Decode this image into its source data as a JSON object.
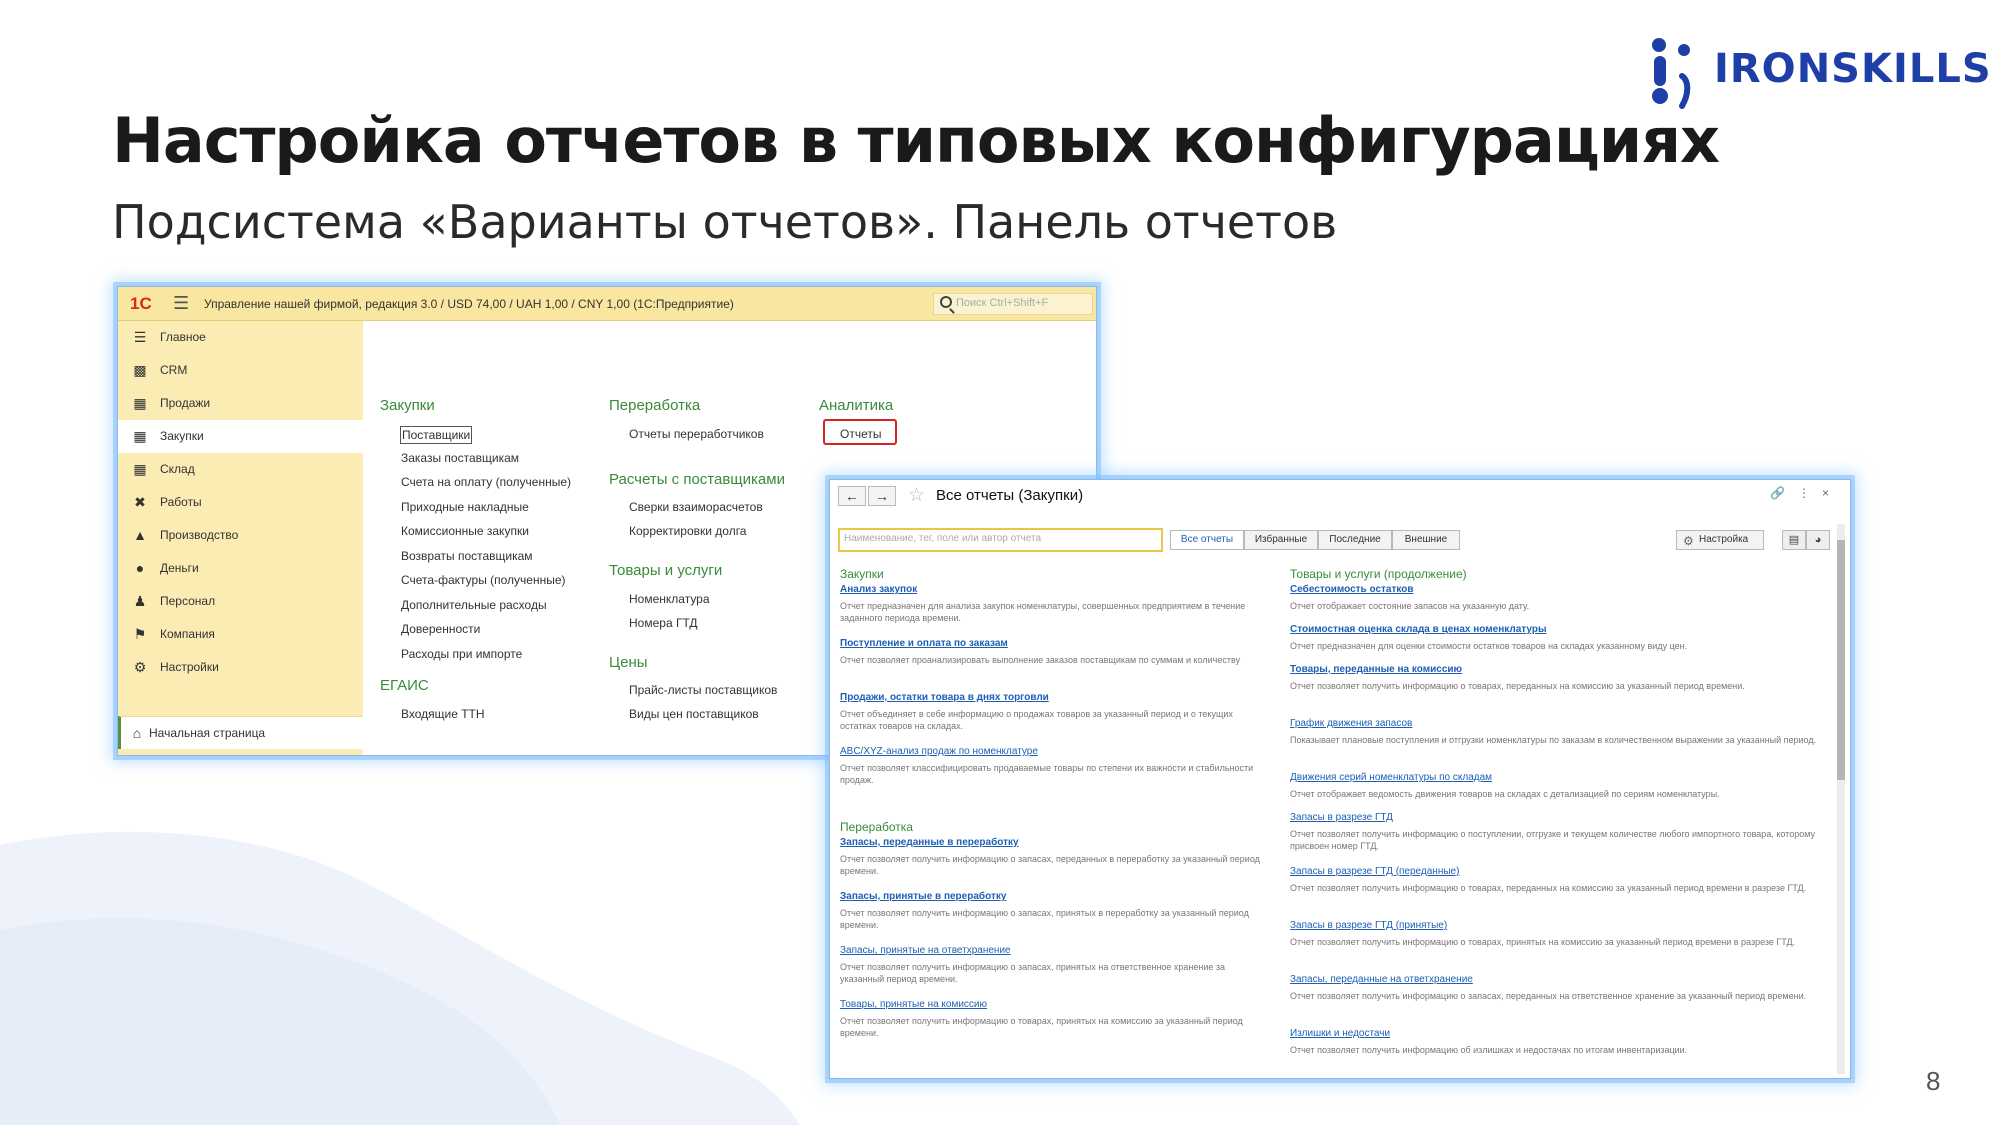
{
  "slide": {
    "brand": "IRONSKILLS",
    "title": "Настройка отчетов в типовых конфигурациях",
    "subtitle": "Подсистема «Варианты отчетов». Панель отчетов",
    "page_number": "8"
  },
  "colors": {
    "brand_blue": "#1f3fa8",
    "onec_yellow": "#f9e6a0",
    "section_green": "#3a8b3a",
    "link_blue": "#1e5fb4",
    "highlight_red": "#d32424"
  },
  "window1": {
    "logo": "1С",
    "app_title": "Управление нашей фирмой, редакция 3.0 / USD 74,00 / UAH 1,00 / CNY 1,00  (1С:Предприятие)",
    "search_placeholder": "Поиск Ctrl+Shift+F",
    "sidebar": [
      {
        "label": "Главное",
        "icon": "menu-icon"
      },
      {
        "label": "CRM",
        "icon": "crm-icon"
      },
      {
        "label": "Продажи",
        "icon": "cart-icon"
      },
      {
        "label": "Закупки",
        "icon": "grid-icon"
      },
      {
        "label": "Склад",
        "icon": "warehouse-icon"
      },
      {
        "label": "Работы",
        "icon": "tools-icon"
      },
      {
        "label": "Производство",
        "icon": "factory-icon"
      },
      {
        "label": "Деньги",
        "icon": "money-icon"
      },
      {
        "label": "Персонал",
        "icon": "people-icon"
      },
      {
        "label": "Компания",
        "icon": "flag-icon"
      },
      {
        "label": "Настройки",
        "icon": "gear-icon"
      }
    ],
    "home": "Начальная страница",
    "sections": {
      "zakupki": {
        "title": "Закупки",
        "items": [
          "Поставщики",
          "Заказы поставщикам",
          "Счета на оплату (полученные)",
          "Приходные накладные",
          "Комиссионные закупки",
          "Возвраты поставщикам",
          "Счета-фактуры (полученные)",
          "Дополнительные расходы",
          "Доверенности",
          "Расходы при импорте"
        ]
      },
      "egais": {
        "title": "ЕГАИС",
        "items": [
          "Входящие ТТН"
        ]
      },
      "pererabotka": {
        "title": "Переработка",
        "items": [
          "Отчеты переработчиков"
        ]
      },
      "raschety": {
        "title": "Расчеты с поставщиками",
        "items": [
          "Сверки взаиморасчетов",
          "Корректировки долга"
        ]
      },
      "tovary": {
        "title": "Товары и услуги",
        "items": [
          "Номенклатура",
          "Номера ГТД"
        ]
      },
      "ceny": {
        "title": "Цены",
        "items": [
          "Прайс-листы поставщиков",
          "Виды цен поставщиков"
        ]
      },
      "analitika": {
        "title": "Аналитика",
        "items": [
          "Отчеты"
        ]
      }
    }
  },
  "window2": {
    "title": "Все отчеты (Закупки)",
    "search_placeholder": "Наименование, тег, поле или автор отчета",
    "tabs": [
      "Все отчеты",
      "Избранные",
      "Последние",
      "Внешние"
    ],
    "settings_label": "Настройка",
    "left_column": [
      {
        "group": "Закупки",
        "reports": [
          {
            "name": "Анализ закупок",
            "desc": "Отчет предназначен для анализа закупок номенклатуры, совершенных предприятием в течение заданного периода времени."
          },
          {
            "name": "Поступление и оплата по заказам",
            "desc": "Отчет позволяет проанализировать выполнение заказов поставщикам по суммам и количеству"
          },
          {
            "name": "Продажи, остатки товара в днях торговли",
            "desc": "Отчет объединяет в себе информацию о продажах товаров за указанный период и о текущих остатках товаров на складах."
          },
          {
            "name": "ABC/XYZ-анализ продаж по номенклатуре",
            "desc": "Отчет позволяет классифицировать продаваемые товары по степени их важности и стабильности продаж."
          }
        ]
      },
      {
        "group": "Переработка",
        "reports": [
          {
            "name": "Запасы, переданные в переработку",
            "desc": "Отчет позволяет получить информацию о запасах, переданных в переработку за указанный период времени."
          },
          {
            "name": "Запасы, принятые в переработку",
            "desc": "Отчет позволяет получить информацию о запасах, принятых в переработку за указанный период времени."
          },
          {
            "name": "Запасы, принятые на ответхранение",
            "desc": "Отчет позволяет получить информацию о запасах, принятых на ответственное хранение за указанный период времени."
          },
          {
            "name": "Товары, принятые на комиссию",
            "desc": "Отчет позволяет получить информацию о товарах, принятых на комиссию за указанный период времени."
          }
        ]
      }
    ],
    "right_column": {
      "group": "Товары и услуги (продолжение)",
      "reports": [
        {
          "name": "Себестоимость остатков",
          "desc": "Отчет отображает состояние запасов на указанную дату."
        },
        {
          "name": "Стоимостная оценка склада в ценах номенклатуры",
          "desc": "Отчет предназначен для оценки стоимости остатков товаров на складах указанному виду цен."
        },
        {
          "name": "Товары, переданные на комиссию",
          "desc": "Отчет позволяет получить информацию о товарах, переданных на комиссию за указанный период времени."
        },
        {
          "name": "График движения запасов",
          "desc": "Показывает плановые поступления и отгрузки номенклатуры по заказам в количественном выражении за указанный период."
        },
        {
          "name": "Движения серий номенклатуры по складам",
          "desc": "Отчет отображает ведомость движения товаров на складах с детализацией по сериям номенклатуры."
        },
        {
          "name": "Запасы в разрезе ГТД",
          "desc": "Отчет позволяет получить информацию о поступлении, отгрузке и текущем количестве любого импортного товара, которому присвоен номер ГТД."
        },
        {
          "name": "Запасы в разрезе ГТД (переданные)",
          "desc": "Отчет позволяет получить информацию о товарах, переданных на комиссию за указанный период времени в разрезе ГТД."
        },
        {
          "name": "Запасы в разрезе ГТД (принятые)",
          "desc": "Отчет позволяет получить информацию о товарах, принятых на комиссию за указанный период времени в разрезе ГТД."
        },
        {
          "name": "Запасы, переданные на ответхранение",
          "desc": "Отчет позволяет получить информацию о запасах, переданных на ответственное хранение за указанный период времени."
        },
        {
          "name": "Излишки и недостачи",
          "desc": "Отчет позволяет получить информацию об излишках и недостачах по итогам инвентаризации."
        }
      ]
    }
  }
}
